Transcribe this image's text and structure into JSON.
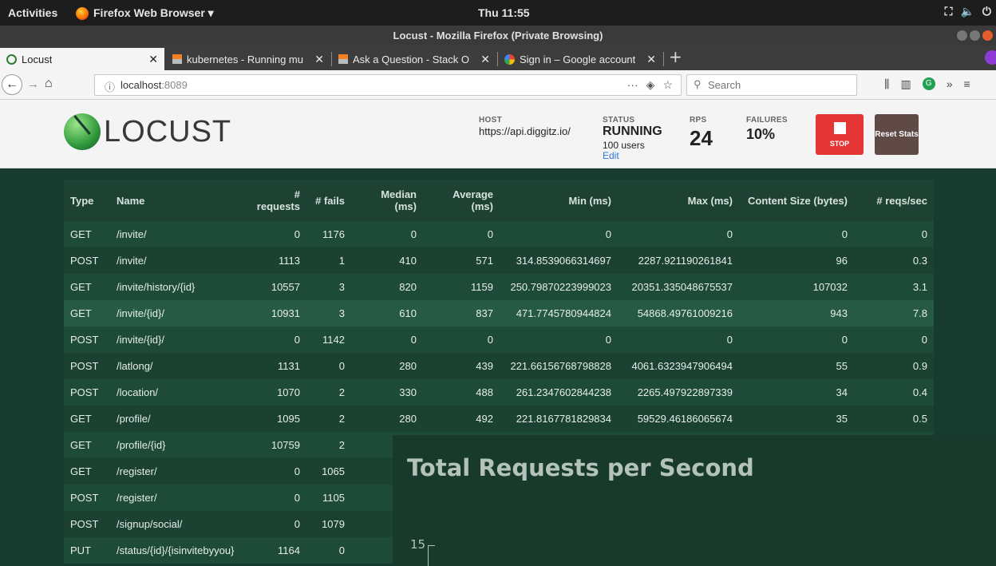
{
  "system": {
    "activities": "Activities",
    "app_menu": "Firefox Web Browser ▾",
    "clock": "Thu 11:55"
  },
  "window": {
    "title": "Locust - Mozilla Firefox (Private Browsing)"
  },
  "tabs": [
    {
      "label": "Locust",
      "icon": "locust-icon"
    },
    {
      "label": "kubernetes - Running mu",
      "icon": "stackoverflow-icon"
    },
    {
      "label": "Ask a Question - Stack O",
      "icon": "stackoverflow-icon"
    },
    {
      "label": "Sign in – Google account",
      "icon": "google-icon"
    }
  ],
  "nav": {
    "url_host": "localhost",
    "url_port": ":8089",
    "search_placeholder": "Search",
    "page_actions": "···"
  },
  "header": {
    "brand": "LOCUST",
    "host_label": "HOST",
    "host": "https://api.diggitz.io/",
    "status_label": "STATUS",
    "status": "RUNNING",
    "users": "100 users",
    "edit": "Edit",
    "rps_label": "RPS",
    "rps": "24",
    "failures_label": "FAILURES",
    "failures": "10%",
    "stop_label": "STOP",
    "reset_label": "Reset Stats"
  },
  "table": {
    "headers": [
      "Type",
      "Name",
      "# requests",
      "# fails",
      "Median (ms)",
      "Average (ms)",
      "Min (ms)",
      "Max (ms)",
      "Content Size (bytes)",
      "# reqs/sec"
    ],
    "rows": [
      [
        "GET",
        "/invite/",
        "0",
        "1176",
        "0",
        "0",
        "0",
        "0",
        "0",
        "0"
      ],
      [
        "POST",
        "/invite/",
        "1113",
        "1",
        "410",
        "571",
        "314.8539066314697",
        "2287.921190261841",
        "96",
        "0.3"
      ],
      [
        "GET",
        "/invite/history/{id}",
        "10557",
        "3",
        "820",
        "1159",
        "250.79870223999023",
        "20351.335048675537",
        "107032",
        "3.1"
      ],
      [
        "GET",
        "/invite/{id}/",
        "10931",
        "3",
        "610",
        "837",
        "471.7745780944824",
        "54868.49761009216",
        "943",
        "7.8"
      ],
      [
        "POST",
        "/invite/{id}/",
        "0",
        "1142",
        "0",
        "0",
        "0",
        "0",
        "0",
        "0"
      ],
      [
        "POST",
        "/latlong/",
        "1131",
        "0",
        "280",
        "439",
        "221.66156768798828",
        "4061.6323947906494",
        "55",
        "0.9"
      ],
      [
        "POST",
        "/location/",
        "1070",
        "2",
        "330",
        "488",
        "261.2347602844238",
        "2265.497922897339",
        "34",
        "0.4"
      ],
      [
        "GET",
        "/profile/",
        "1095",
        "2",
        "280",
        "492",
        "221.8167781829834",
        "59529.46186065674",
        "35",
        "0.5"
      ],
      [
        "GET",
        "/profile/{id}",
        "10759",
        "2",
        "",
        "",
        "",
        "",
        "",
        ""
      ],
      [
        "GET",
        "/register/",
        "0",
        "1065",
        "",
        "",
        "",
        "",
        "",
        ""
      ],
      [
        "POST",
        "/register/",
        "0",
        "1105",
        "",
        "",
        "",
        "",
        "",
        ""
      ],
      [
        "POST",
        "/signup/social/",
        "0",
        "1079",
        "",
        "",
        "",
        "",
        "",
        ""
      ],
      [
        "PUT",
        "/status/{id}/{isinvitebyyou}",
        "1164",
        "0",
        "",
        "",
        "",
        "",
        "",
        ""
      ]
    ]
  },
  "chart_data": {
    "type": "line",
    "title": "Total Requests per Second",
    "y_ticks": [
      "15"
    ],
    "series": []
  }
}
